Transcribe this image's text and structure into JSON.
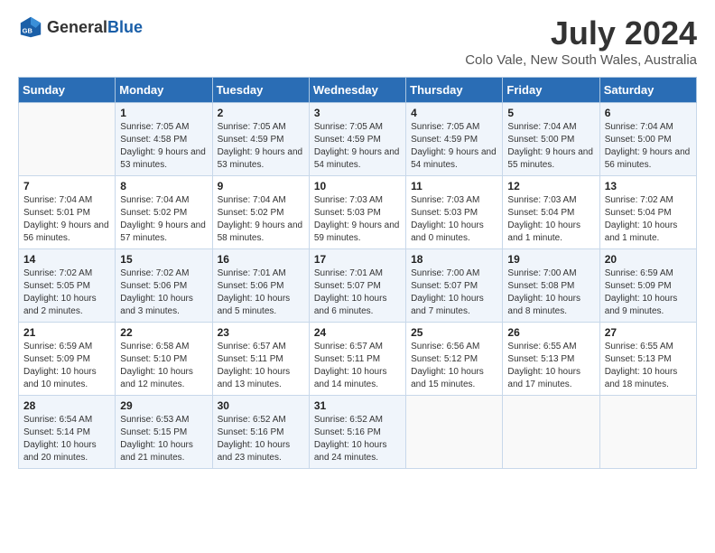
{
  "header": {
    "logo_general": "General",
    "logo_blue": "Blue",
    "title": "July 2024",
    "subtitle": "Colo Vale, New South Wales, Australia"
  },
  "weekdays": [
    "Sunday",
    "Monday",
    "Tuesday",
    "Wednesday",
    "Thursday",
    "Friday",
    "Saturday"
  ],
  "weeks": [
    [
      {
        "day": "",
        "sunrise": "",
        "sunset": "",
        "daylight": ""
      },
      {
        "day": "1",
        "sunrise": "Sunrise: 7:05 AM",
        "sunset": "Sunset: 4:58 PM",
        "daylight": "Daylight: 9 hours and 53 minutes."
      },
      {
        "day": "2",
        "sunrise": "Sunrise: 7:05 AM",
        "sunset": "Sunset: 4:59 PM",
        "daylight": "Daylight: 9 hours and 53 minutes."
      },
      {
        "day": "3",
        "sunrise": "Sunrise: 7:05 AM",
        "sunset": "Sunset: 4:59 PM",
        "daylight": "Daylight: 9 hours and 54 minutes."
      },
      {
        "day": "4",
        "sunrise": "Sunrise: 7:05 AM",
        "sunset": "Sunset: 4:59 PM",
        "daylight": "Daylight: 9 hours and 54 minutes."
      },
      {
        "day": "5",
        "sunrise": "Sunrise: 7:04 AM",
        "sunset": "Sunset: 5:00 PM",
        "daylight": "Daylight: 9 hours and 55 minutes."
      },
      {
        "day": "6",
        "sunrise": "Sunrise: 7:04 AM",
        "sunset": "Sunset: 5:00 PM",
        "daylight": "Daylight: 9 hours and 56 minutes."
      }
    ],
    [
      {
        "day": "7",
        "sunrise": "Sunrise: 7:04 AM",
        "sunset": "Sunset: 5:01 PM",
        "daylight": "Daylight: 9 hours and 56 minutes."
      },
      {
        "day": "8",
        "sunrise": "Sunrise: 7:04 AM",
        "sunset": "Sunset: 5:02 PM",
        "daylight": "Daylight: 9 hours and 57 minutes."
      },
      {
        "day": "9",
        "sunrise": "Sunrise: 7:04 AM",
        "sunset": "Sunset: 5:02 PM",
        "daylight": "Daylight: 9 hours and 58 minutes."
      },
      {
        "day": "10",
        "sunrise": "Sunrise: 7:03 AM",
        "sunset": "Sunset: 5:03 PM",
        "daylight": "Daylight: 9 hours and 59 minutes."
      },
      {
        "day": "11",
        "sunrise": "Sunrise: 7:03 AM",
        "sunset": "Sunset: 5:03 PM",
        "daylight": "Daylight: 10 hours and 0 minutes."
      },
      {
        "day": "12",
        "sunrise": "Sunrise: 7:03 AM",
        "sunset": "Sunset: 5:04 PM",
        "daylight": "Daylight: 10 hours and 1 minute."
      },
      {
        "day": "13",
        "sunrise": "Sunrise: 7:02 AM",
        "sunset": "Sunset: 5:04 PM",
        "daylight": "Daylight: 10 hours and 1 minute."
      }
    ],
    [
      {
        "day": "14",
        "sunrise": "Sunrise: 7:02 AM",
        "sunset": "Sunset: 5:05 PM",
        "daylight": "Daylight: 10 hours and 2 minutes."
      },
      {
        "day": "15",
        "sunrise": "Sunrise: 7:02 AM",
        "sunset": "Sunset: 5:06 PM",
        "daylight": "Daylight: 10 hours and 3 minutes."
      },
      {
        "day": "16",
        "sunrise": "Sunrise: 7:01 AM",
        "sunset": "Sunset: 5:06 PM",
        "daylight": "Daylight: 10 hours and 5 minutes."
      },
      {
        "day": "17",
        "sunrise": "Sunrise: 7:01 AM",
        "sunset": "Sunset: 5:07 PM",
        "daylight": "Daylight: 10 hours and 6 minutes."
      },
      {
        "day": "18",
        "sunrise": "Sunrise: 7:00 AM",
        "sunset": "Sunset: 5:07 PM",
        "daylight": "Daylight: 10 hours and 7 minutes."
      },
      {
        "day": "19",
        "sunrise": "Sunrise: 7:00 AM",
        "sunset": "Sunset: 5:08 PM",
        "daylight": "Daylight: 10 hours and 8 minutes."
      },
      {
        "day": "20",
        "sunrise": "Sunrise: 6:59 AM",
        "sunset": "Sunset: 5:09 PM",
        "daylight": "Daylight: 10 hours and 9 minutes."
      }
    ],
    [
      {
        "day": "21",
        "sunrise": "Sunrise: 6:59 AM",
        "sunset": "Sunset: 5:09 PM",
        "daylight": "Daylight: 10 hours and 10 minutes."
      },
      {
        "day": "22",
        "sunrise": "Sunrise: 6:58 AM",
        "sunset": "Sunset: 5:10 PM",
        "daylight": "Daylight: 10 hours and 12 minutes."
      },
      {
        "day": "23",
        "sunrise": "Sunrise: 6:57 AM",
        "sunset": "Sunset: 5:11 PM",
        "daylight": "Daylight: 10 hours and 13 minutes."
      },
      {
        "day": "24",
        "sunrise": "Sunrise: 6:57 AM",
        "sunset": "Sunset: 5:11 PM",
        "daylight": "Daylight: 10 hours and 14 minutes."
      },
      {
        "day": "25",
        "sunrise": "Sunrise: 6:56 AM",
        "sunset": "Sunset: 5:12 PM",
        "daylight": "Daylight: 10 hours and 15 minutes."
      },
      {
        "day": "26",
        "sunrise": "Sunrise: 6:55 AM",
        "sunset": "Sunset: 5:13 PM",
        "daylight": "Daylight: 10 hours and 17 minutes."
      },
      {
        "day": "27",
        "sunrise": "Sunrise: 6:55 AM",
        "sunset": "Sunset: 5:13 PM",
        "daylight": "Daylight: 10 hours and 18 minutes."
      }
    ],
    [
      {
        "day": "28",
        "sunrise": "Sunrise: 6:54 AM",
        "sunset": "Sunset: 5:14 PM",
        "daylight": "Daylight: 10 hours and 20 minutes."
      },
      {
        "day": "29",
        "sunrise": "Sunrise: 6:53 AM",
        "sunset": "Sunset: 5:15 PM",
        "daylight": "Daylight: 10 hours and 21 minutes."
      },
      {
        "day": "30",
        "sunrise": "Sunrise: 6:52 AM",
        "sunset": "Sunset: 5:16 PM",
        "daylight": "Daylight: 10 hours and 23 minutes."
      },
      {
        "day": "31",
        "sunrise": "Sunrise: 6:52 AM",
        "sunset": "Sunset: 5:16 PM",
        "daylight": "Daylight: 10 hours and 24 minutes."
      },
      {
        "day": "",
        "sunrise": "",
        "sunset": "",
        "daylight": ""
      },
      {
        "day": "",
        "sunrise": "",
        "sunset": "",
        "daylight": ""
      },
      {
        "day": "",
        "sunrise": "",
        "sunset": "",
        "daylight": ""
      }
    ]
  ]
}
